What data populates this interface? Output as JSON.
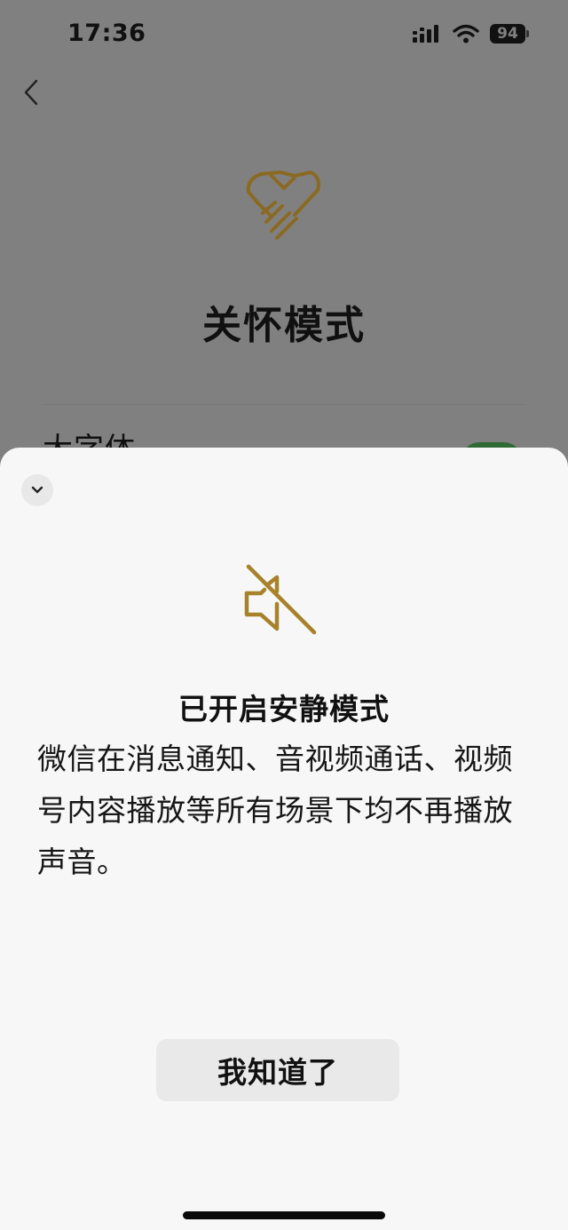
{
  "status_bar": {
    "time": "17:36",
    "battery": "94",
    "icons": [
      "signal-icon",
      "wifi-icon",
      "battery-icon"
    ]
  },
  "background_page": {
    "title": "关怀模式",
    "setting_label": "大字体",
    "icons": [
      "back-chevron-icon",
      "care-mode-hand-heart-icon"
    ]
  },
  "sheet": {
    "title": "已开启安静模式",
    "description": "微信在消息通知、音视频通话、视频号内容播放等所有场景下均不再播放声音。",
    "confirm_label": "我知道了",
    "icons": [
      "chevron-down-icon",
      "speaker-muted-icon"
    ]
  },
  "colors": {
    "accent_gold": "#a8822a",
    "overlay_gray": "#808080",
    "sheet_background": "#f7f7f7",
    "button_background": "#e9e9e9",
    "toggle_green": "#2f6a34"
  }
}
